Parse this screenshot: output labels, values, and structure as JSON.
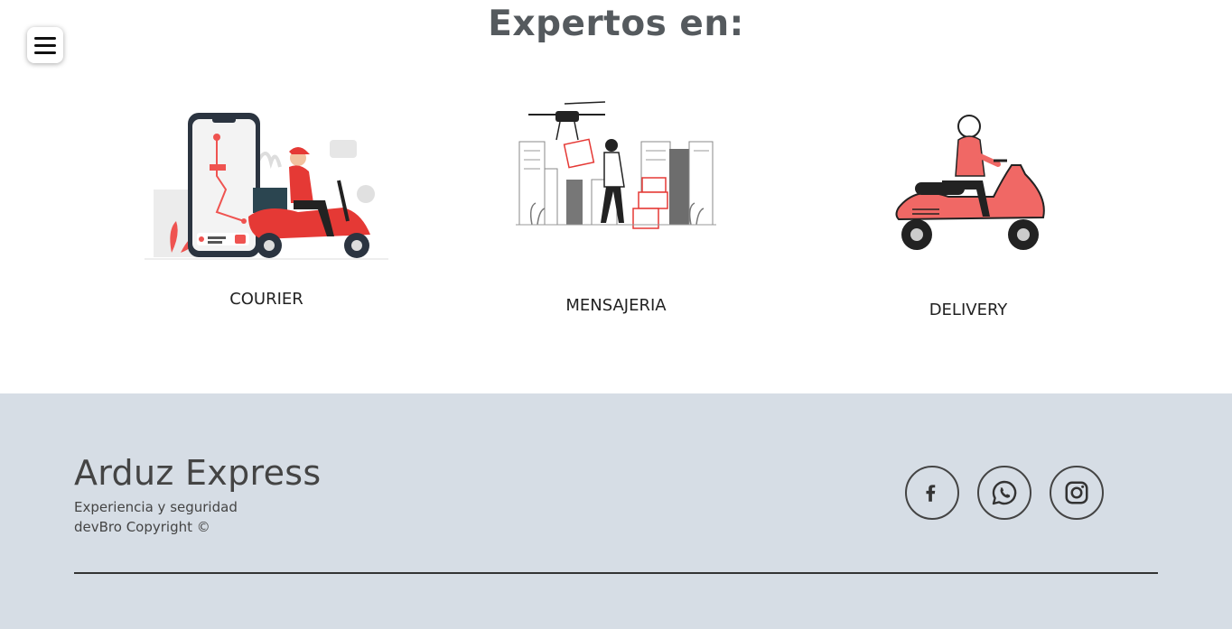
{
  "header": {
    "title": "Expertos en:",
    "menu_icon": "hamburger-menu-icon"
  },
  "services": [
    {
      "label": "COURIER",
      "illustration": "phone-map-scooter-illustration"
    },
    {
      "label": "MENSAJERIA",
      "illustration": "drone-delivery-illustration"
    },
    {
      "label": "DELIVERY",
      "illustration": "scooter-rider-illustration"
    }
  ],
  "footer": {
    "brand": "Arduz Express",
    "tagline": "Experiencia y seguridad",
    "copyright": "devBro Copyright ©",
    "social": [
      {
        "name": "facebook-icon"
      },
      {
        "name": "whatsapp-icon"
      },
      {
        "name": "instagram-icon"
      }
    ]
  },
  "colors": {
    "accent": "#ef5350",
    "footer_bg": "#d6dde5",
    "title": "#555a5e"
  }
}
